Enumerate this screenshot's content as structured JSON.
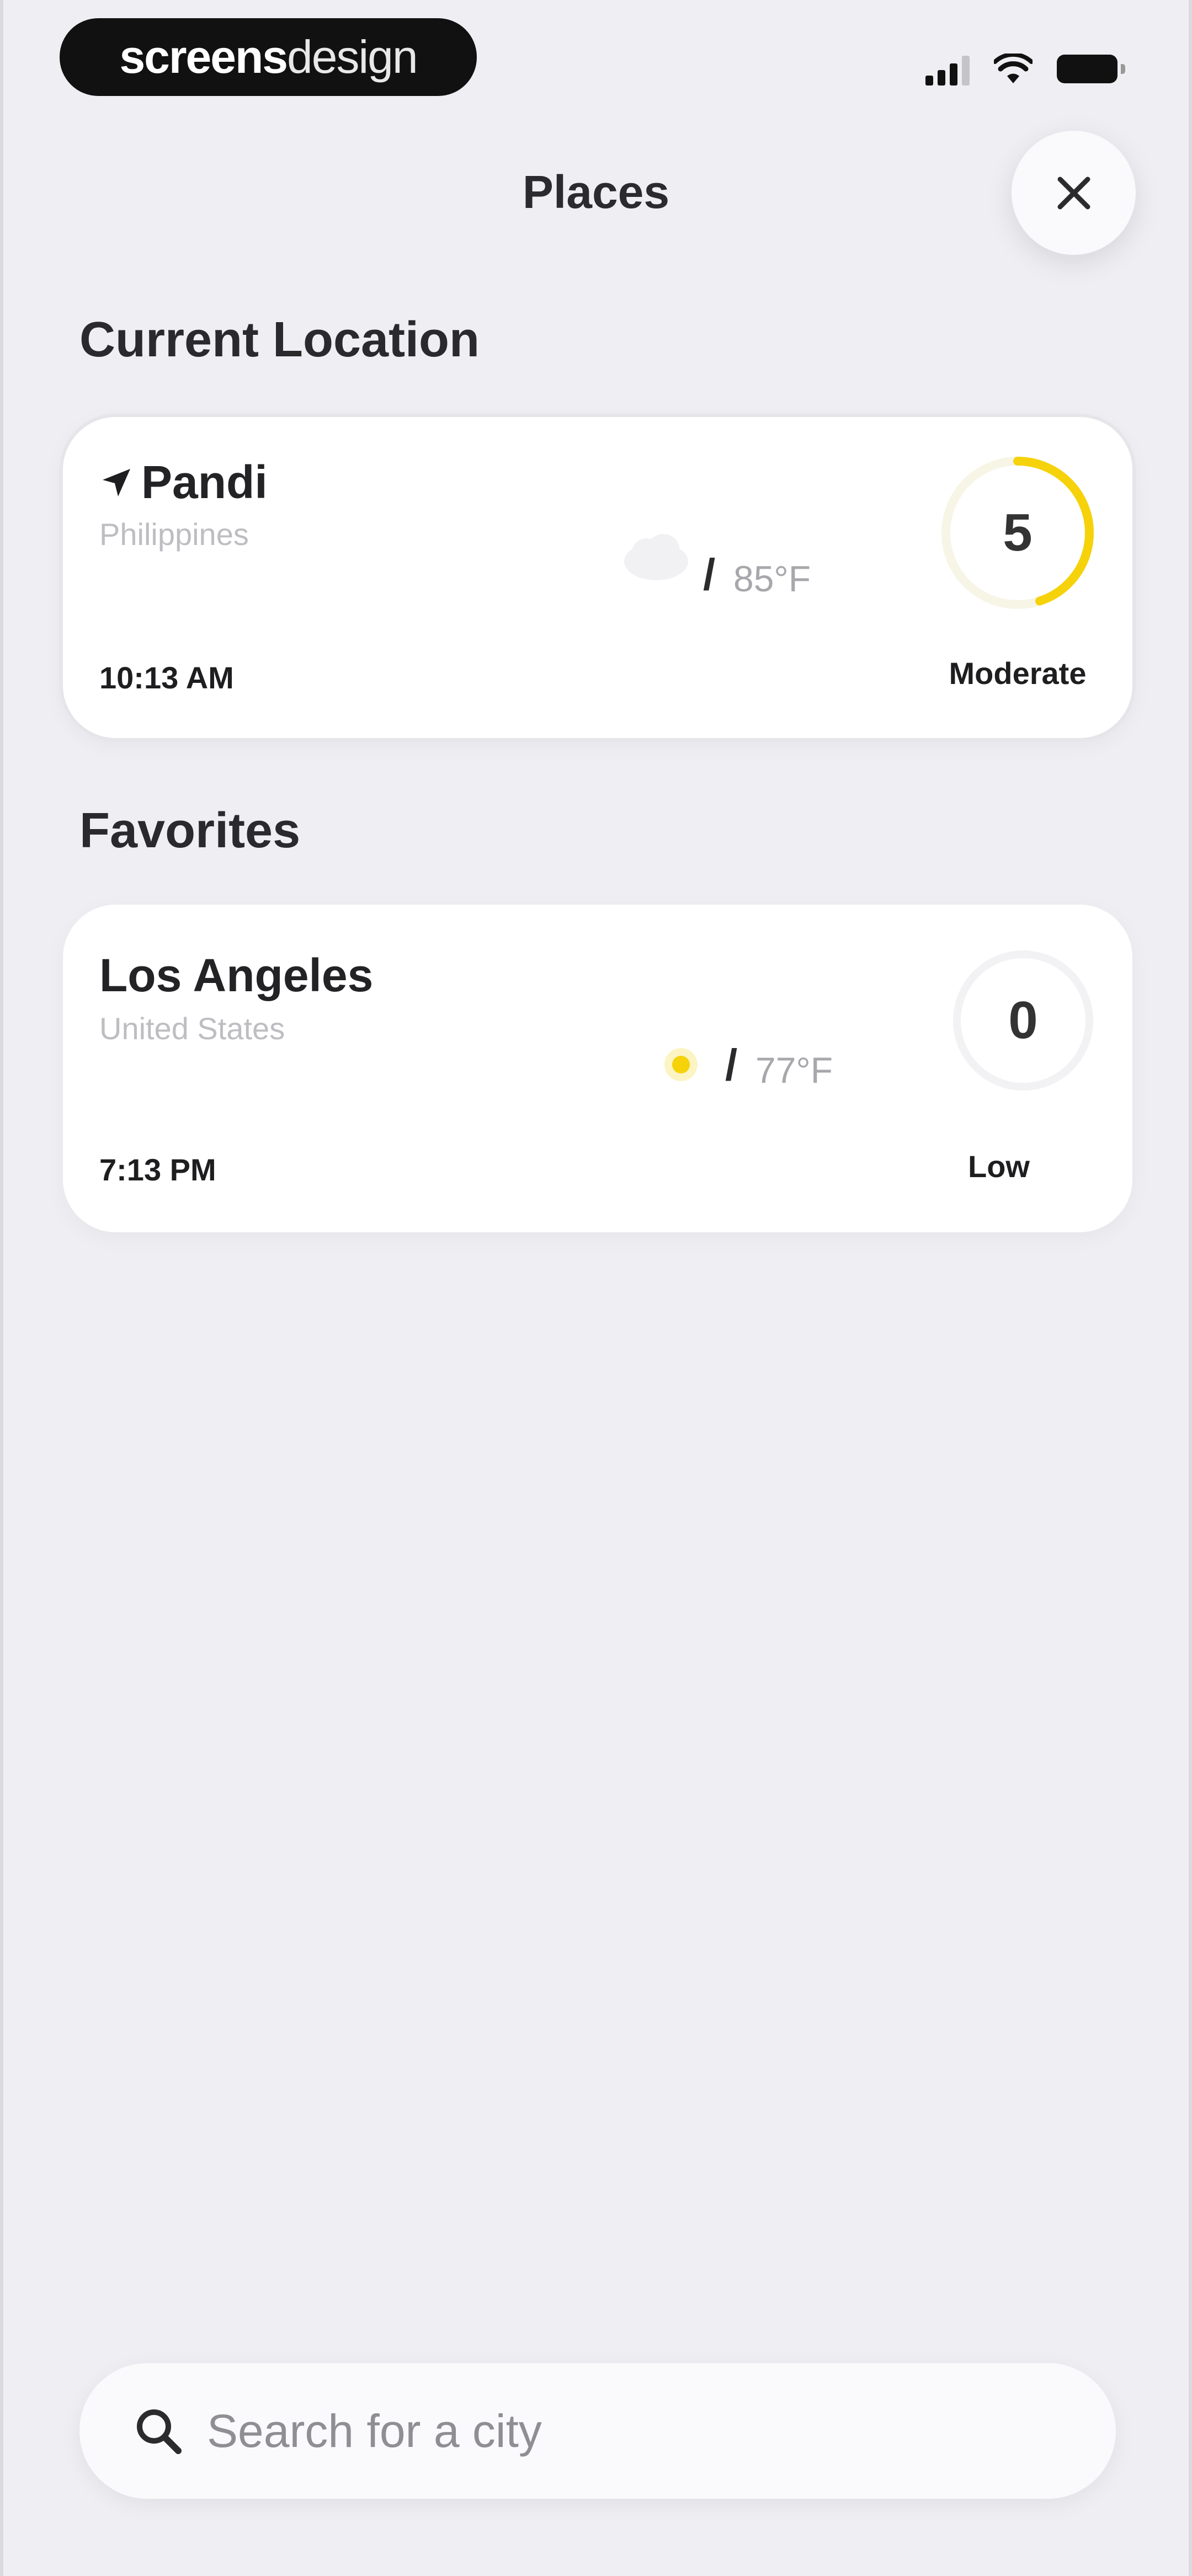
{
  "status_bar": {
    "brand_bold": "screens",
    "brand_light": "design"
  },
  "header": {
    "title": "Places"
  },
  "sections": {
    "current": "Current Location",
    "favorites": "Favorites"
  },
  "current_location": {
    "city": "Pandi",
    "country": "Philippines",
    "time": "10:13 AM",
    "temperature": "85°F",
    "separator": "/",
    "weather_icon": "cloud-icon",
    "uv_index": "5",
    "uv_level": "Moderate",
    "uv_fraction": 0.45,
    "accent": "#f5d20a"
  },
  "favorites": [
    {
      "city": "Los Angeles",
      "country": "United States",
      "time": "7:13 PM",
      "temperature": "77°F",
      "separator": "/",
      "weather_icon": "sun-icon",
      "uv_index": "0",
      "uv_level": "Low",
      "uv_fraction": 0,
      "accent": "#f5d20a"
    }
  ],
  "search": {
    "placeholder": "Search for a city"
  }
}
